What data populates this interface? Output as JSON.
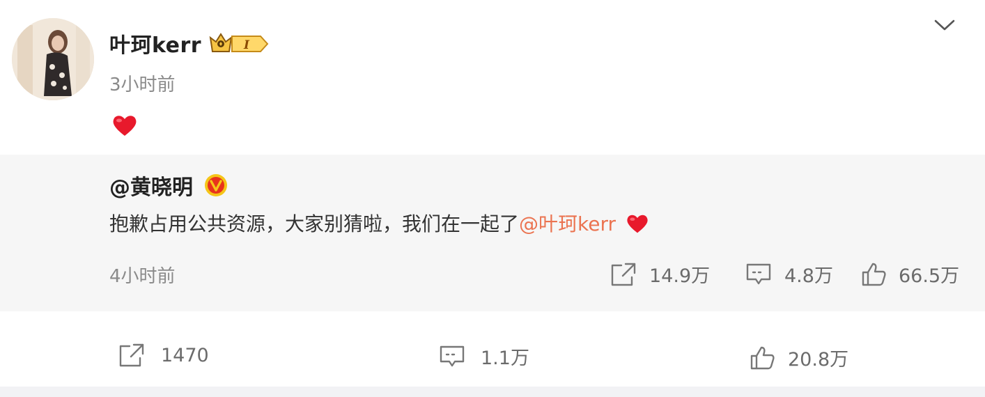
{
  "post": {
    "author": "叶珂kerr",
    "time": "3小时前",
    "text_emoji": "heart-emoji",
    "vip_level": "I"
  },
  "repost": {
    "author": "@黄晓明",
    "verified_badge": "V",
    "text": "抱歉占用公共资源，大家别猜啦，我们在一起了",
    "mention": "@叶珂kerr",
    "time": "4小时前",
    "actions": {
      "share_count": "14.9万",
      "comment_count": "4.8万",
      "like_count": "66.5万"
    }
  },
  "actions": {
    "share_count": "1470",
    "comment_count": "1.1万",
    "like_count": "20.8万"
  },
  "colors": {
    "mention": "#eb7350",
    "repost_bg": "#f6f6f6",
    "muted_text": "#8a8a8a",
    "heart": "#e8192c",
    "verified_badge": "#f5c518"
  },
  "icons": {
    "more": "chevron-down-icon",
    "share": "share-icon",
    "comment": "comment-icon",
    "like": "thumbs-up-icon"
  }
}
